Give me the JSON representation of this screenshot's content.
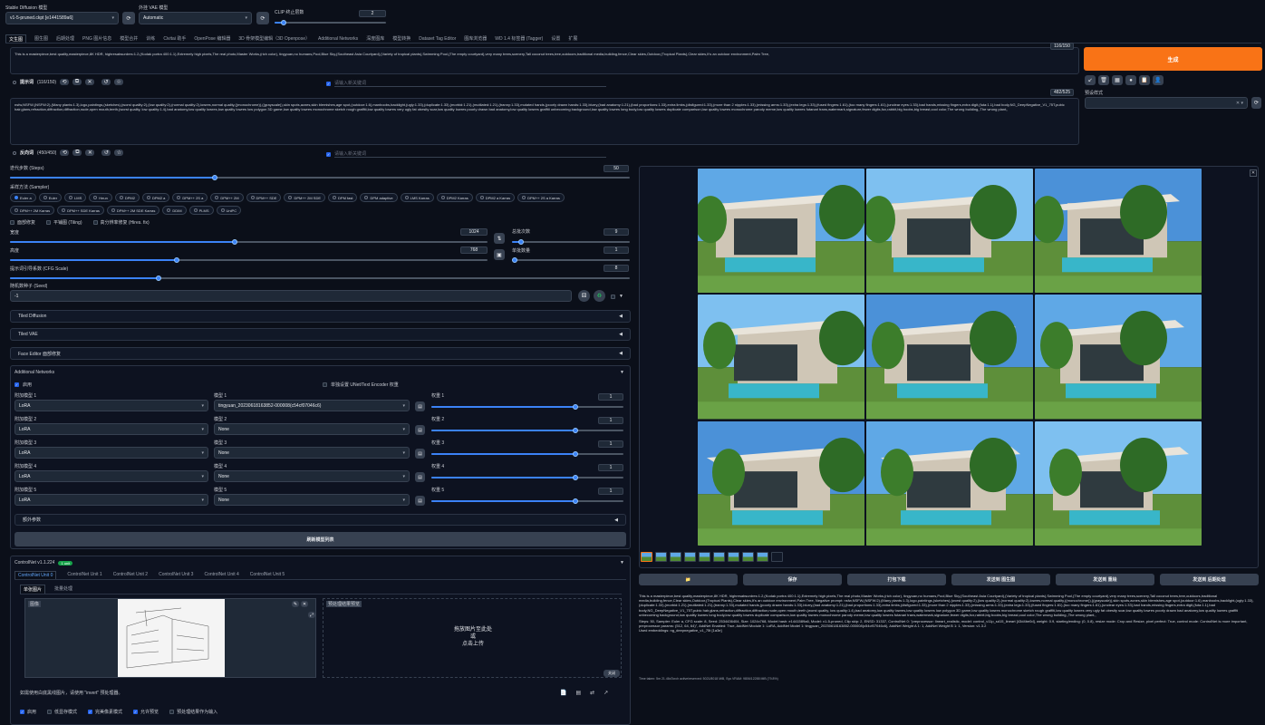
{
  "topbar": {
    "checkpoint_label": "Stable Diffusion 模型",
    "checkpoint_value": "v1-5-pruned.ckpt [e1441589a6]",
    "vae_label": "外挂 VAE 模型",
    "vae_value": "Automatic",
    "clip_label": "CLIP 终止层数",
    "clip_value": "2",
    "clip_fraction": 0.08
  },
  "tabs": [
    "文生图",
    "图生图",
    "后期处理",
    "PNG 图片信息",
    "模型合并",
    "训练",
    "Civitai 助手",
    "OpenPose 编辑器",
    "3D 骨架模型编辑（3D Openpose）",
    "Additional Networks",
    "深度图库",
    "模型转换",
    "Dataset Tag Editor",
    "图库浏览器",
    "WD 1.4 标签器 (Tagger)",
    "设置",
    "扩展"
  ],
  "prompt": {
    "text": "This is a masterpiece,best quality,masterpiece,8K HDR, highresabsurdres:1.2,(Kodak portra 400:1.1),Extremely high pixels,The real photo,Master Works,(rich color), tingyuan,no humans,Pool,Blue Sky,(Southeast Asia Courtyard),(Variety of tropical plants),Swimming Pool,(The empty courtyard),very many trees,scenery,Tall coconut trees,tree,outdoors,traditional media,building,fence,Clear skies,Outdoor,(Tropical Plants),Clear skies,It's an outdoor environment,Palm Tree,",
    "counter": "116/150",
    "toolbar_label": "提示词",
    "toolbar_count": "(116/150)",
    "input_placeholder": "请输入新关键词"
  },
  "negative": {
    "text": "nsfw,NSFW,(NSFW:2),(Many plants:1.3),logo,paintings,(sketches),(worst quality:2),(low quality:2),(normal quality:2),lowres,normal quality,((monochrome)),((grayscale)),skin spots,acnes,skin blemishes,age spot,(outdoor:1.6),manboobs,backlight,(ugly:1.33),(duplicate:1.33),(morbid:1.21),(mutilated:1.21),(tranny:1.33),mutated hands,(poorly drawn hands:1.33),blurry,(bad anatomy:1.21),(bad proportions:1.33),extra limbs,(disfigured:1.33),(more than 2 nipples:1.33),(missing arms:1.33),(extra legs:1.33),(fused fingers:1.61),(too many fingers:1.61),(unclear eyes:1.33),bad hands,missing fingers,extra digit,(futa:1.1),bad body,NG_DeepNegative_V1_75T,pubic hair,glans,refraction,diffraction,diffraction,nude,open mouth,teeth,(worst quality, low quality:1.4),bad anatomy,low quality lowres,low quality lowres low polygon 3D game,low quality lowres monochrome sketch rough graffiti,low quality lowres very ugly fat obesity scar,low quality lowres poorly drawn bad anatomy,low quality lowres graffiti unbecoming background,low quality lowres long body,low quality lowres duplicate comparison,low quality lowres monochrome parody meme,low quality lowres futanari trans,watermark,signature,fewer digits,fox,rabbit,big boobs,big breast,cool color,The wrong building,,The wrong plant,,",
    "counter": "482/525",
    "toolbar_label": "反向词",
    "toolbar_count": "(450/450)",
    "input_placeholder": "请输入新关键词"
  },
  "steps": {
    "label": "迭代步数 (Steps)",
    "value": "50",
    "fraction": 0.33
  },
  "sampler": {
    "label": "采样方法 (Sampler)",
    "selected": "Euler a",
    "row1": [
      "Euler a",
      "Euler",
      "LMS",
      "Heun",
      "DPM2",
      "DPM2 a",
      "DPM++ 2S a",
      "DPM++ 2M",
      "DPM++ SDE",
      "DPM++ 2M SDE",
      "DPM fast",
      "DPM adaptive",
      "LMS Karras",
      "DPM2 Karras",
      "DPM2 a Karras",
      "DPM++ 2S a Karras"
    ],
    "row2": [
      "DPM++ 2M Karras",
      "DPM++ SDE Karras",
      "DPM++ 2M SDE Karras",
      "DDIM",
      "PLMS",
      "UniPC"
    ]
  },
  "options": [
    "面部修复",
    "平铺图 (Tiling)",
    "高分辨率修复 (Hires. fix)"
  ],
  "width": {
    "label": "宽度",
    "value": "1024",
    "fraction": 0.47
  },
  "height": {
    "label": "高度",
    "value": "768",
    "fraction": 0.35
  },
  "batch_count": {
    "label": "总批次数",
    "value": "9",
    "fraction": 0.08
  },
  "batch_size": {
    "label": "单批数量",
    "value": "1",
    "fraction": 0.0
  },
  "cfg": {
    "label": "提示词引导系数 (CFG Scale)",
    "value": "8",
    "fraction": 0.24
  },
  "seed": {
    "label": "随机数种子 (Seed)",
    "value": "-1"
  },
  "accordions": [
    "Tiled Diffusion",
    "Tiled VAE",
    "Face Editor 面部修复"
  ],
  "addnet": {
    "title": "Additional Networks",
    "enable": "启用",
    "sep_label": "单独设置 UNet/Text Encoder 权重",
    "rows": [
      {
        "type_label": "附加模型 1",
        "type": "LoRA",
        "model_label": "模型 1",
        "model": "tingyuan_20230618163852-000008(c54cf07046c6)",
        "weight_label": "权重 1",
        "weight": "1",
        "fraction": 0.75
      },
      {
        "type_label": "附加模型 2",
        "type": "LoRA",
        "model_label": "模型 2",
        "model": "None",
        "weight_label": "权重 2",
        "weight": "1",
        "fraction": 0.75
      },
      {
        "type_label": "附加模型 3",
        "type": "LoRA",
        "model_label": "模型 3",
        "model": "None",
        "weight_label": "权重 3",
        "weight": "1",
        "fraction": 0.75
      },
      {
        "type_label": "附加模型 4",
        "type": "LoRA",
        "model_label": "模型 4",
        "model": "None",
        "weight_label": "权重 4",
        "weight": "1",
        "fraction": 0.75
      },
      {
        "type_label": "附加模型 5",
        "type": "LoRA",
        "model_label": "模型 5",
        "model": "None",
        "weight_label": "权重 5",
        "weight": "1",
        "fraction": 0.75
      }
    ],
    "extra": "额外参数",
    "refresh": "刷新模型列表"
  },
  "controlnet": {
    "title": "ControlNet v1.1.224",
    "badge": "1 unit",
    "units": [
      "ControlNet Unit 0",
      "ControlNet Unit 1",
      "ControlNet Unit 2",
      "ControlNet Unit 3",
      "ControlNet Unit 4",
      "ControlNet Unit 5"
    ],
    "subtabs": [
      "单张图片",
      "批量处理"
    ],
    "image_label": "图像",
    "preview_label": "预处理结果预览",
    "drop_line1": "拖放图片至此处",
    "drop_line2": "或",
    "drop_line3": "点击上传",
    "close": "关闭",
    "hint": "如需使用白底黑线图片，请使用 \"invert\" 预处理器。",
    "checks": [
      {
        "label": "启用",
        "on": true
      },
      {
        "label": "低显存模式",
        "on": false
      },
      {
        "label": "完美像素模式",
        "on": true
      },
      {
        "label": "允许预览",
        "on": true
      },
      {
        "label": "预处理结果作为输入",
        "on": false
      }
    ]
  },
  "right": {
    "generate": "生成",
    "style_label": "预设样式",
    "icon_tools": [
      "↙",
      "🗑",
      "▦",
      "●",
      "📋",
      "👤"
    ],
    "gallery_actions": [
      "📁",
      "保存",
      "打包下载",
      "发送到 图生图",
      "发送到 重绘",
      "发送到 后期处理"
    ],
    "info_text": "This is a masterpiece,best quality,masterpiece,8K HDR, highresabsurdres:1.2,(Kodak portra 400:1.1),Extremely high pixels,The real photo,Master Works,(rich color), tingyuan,no humans,Pool,Blue Sky,(Southeast Asia Courtyard),(Variety of tropical plants),Swimming Pool,(The empty courtyard),very many trees,scenery,Tall coconut trees,tree,outdoors,traditional media,building,fence,Clear skies,Outdoor,(Tropical Plants),Clear skies,It's an outdoor environment,Palm Tree, Negative prompt: nsfw,NSFW,(NSFW:2),(Many plants:1.3),logo,paintings,(sketches),(worst quality:2),(low quality:2),(normal quality:2),lowres,normal quality,((monochrome)),((grayscale)),skin spots,acnes,skin blemishes,age spot,(outdoor:1.6),manboobs,backlight,(ugly:1.33),(duplicate:1.33),(morbid:1.21),(mutilated:1.21),(tranny:1.33),mutated hands,(poorly drawn hands:1.33),blurry,(bad anatomy:1.21),(bad proportions:1.33),extra limbs,(disfigured:1.33),(more than 2 nipples:1.33),(missing arms:1.33),(extra legs:1.33),(fused fingers:1.61),(too many fingers:1.61),(unclear eyes:1.33),bad hands,missing fingers,extra digit,(futa:1.1),bad body,NG_DeepNegative_V1_75T,pubic hair,glans,refraction,diffraction,diffraction,nude,open mouth,teeth,(worst quality, low quality:1.4),bad anatomy,low quality lowres,low quality lowres low polygon 3D game,low quality lowres monochrome sketch rough graffiti,low quality lowres very ugly fat obesity scar,low quality lowres poorly drawn bad anatomy,low quality lowres graffiti unbecoming background,low quality lowres long body,low quality lowres duplicate comparison,low quality lowres monochrome parody meme,low quality lowres futanari trans,watermark,signature,fewer digits,fox,rabbit,big boobs,big breast,cool color,The wrong building,,The wrong plant,,",
    "params_text": "Steps: 50, Sampler: Euler a, CFG scale: 8, Seed: 2534436404, Size: 1024x768, Model hash: e1441589a6, Model: v1-5-pruned, Clip skip: 2, ENSD: 31337, ControlNet 0: \"preprocessor: lineart_realistic, model: control_v11p_sd15_lineart [43d4be0d], weight: 0.9, starting/ending: (0, 0.8), resize mode: Crop and Resize, pixel perfect: True, control mode: ControlNet is more important, preprocessor params: (512, 64, 64)\", AddNet Enabled: True, AddNet Module 1: LoRA, AddNet Model 1: tingyuan_20230618163852-000008(c54cf07046c6), AddNet Weight A 1: 1, AddNet Weight B 1: 1, Version: v1.3.2",
    "embeddings_text": "Used embeddings: ng_deepnegative_v1_75t [1a3e]",
    "time_text": "Time taken: 5m 21.46sTorch active/reserved: 5021/8018 MiB, Sys VRAM: 9806/12288 MiB (79.8%)"
  }
}
